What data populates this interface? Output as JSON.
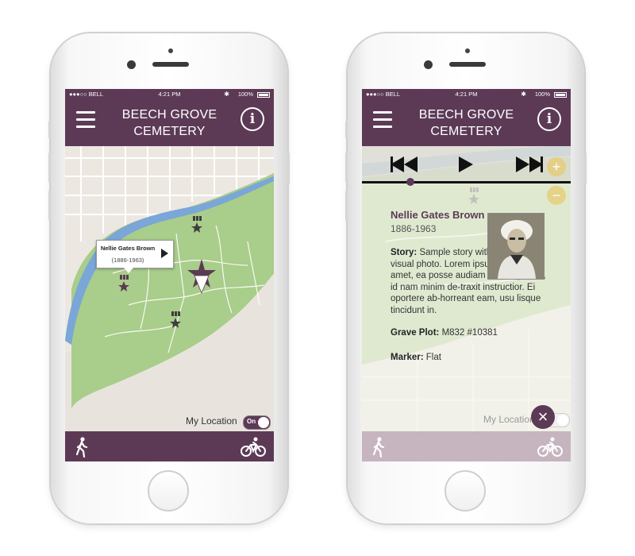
{
  "app": {
    "title_line1": "BEECH GROVE",
    "title_line2": "CEMETERY"
  },
  "status_bar": {
    "carrier": "●●●○○ BELL",
    "time": "4:21 PM",
    "battery": "100%"
  },
  "map": {
    "callout": {
      "name": "Nellie Gates Brown",
      "years": "(1886-1963)"
    },
    "my_location_label": "My Location",
    "toggle_state": "On",
    "park_color": "#a9cd8a",
    "river_color": "#7aa6d8"
  },
  "detail": {
    "name": "Nellie Gates Brown",
    "years": "1886-1963",
    "story_label": "Story:",
    "story_text": "Sample story with audio and visual photo. Lorem ipsum dolor sit amet, ea posse audiam cotidieque vix, id nam minim de-traxit instructior. Ei oportere ab-horreant eam, usu lisque tincidunt in.",
    "grave_label": "Grave Plot:",
    "grave_value": "M832 #10381",
    "marker_label": "Marker:",
    "marker_value": "Flat",
    "my_location_label": "My Location",
    "zoom_in": "+",
    "zoom_out": "−",
    "close": "×"
  },
  "icons": {
    "menu": "hamburger-icon",
    "info": "i",
    "walk": "walking-person-icon",
    "bike": "bicycle-icon"
  },
  "colors": {
    "brand": "#5c3a56",
    "accent_zoom": "#e8cb70"
  }
}
